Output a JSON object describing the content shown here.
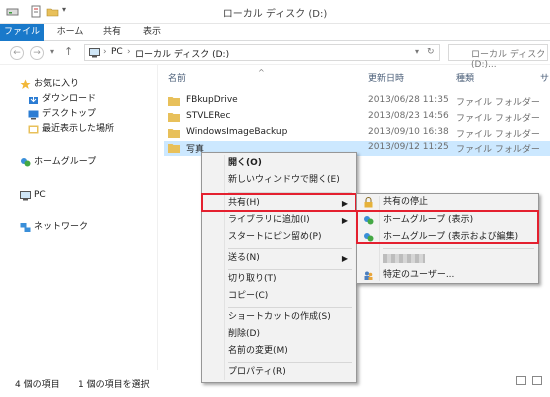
{
  "window": {
    "title": "ローカル ディスク (D:)"
  },
  "ribbon": {
    "tabs": [
      "ファイル",
      "ホーム",
      "共有",
      "表示"
    ]
  },
  "address": {
    "path": [
      "PC",
      "ローカル ディスク (D:)"
    ],
    "search_placeholder": "ローカル ディスク (D:)..."
  },
  "nav": {
    "favorites": "お気に入り",
    "downloads": "ダウンロード",
    "desktop": "デスクトップ",
    "recent": "最近表示した場所",
    "homegroup": "ホームグループ",
    "pc": "PC",
    "network": "ネットワーク"
  },
  "columns": {
    "name": "名前",
    "date": "更新日時",
    "type": "種類",
    "extra": "サ"
  },
  "files": [
    {
      "name": "FBkupDrive",
      "date": "2013/06/28 11:35",
      "type": "ファイル フォルダー"
    },
    {
      "name": "STVLERec",
      "date": "2013/08/23 14:56",
      "type": "ファイル フォルダー"
    },
    {
      "name": "WindowsImageBackup",
      "date": "2013/09/10 16:38",
      "type": "ファイル フォルダー"
    },
    {
      "name": "写真",
      "date": "2013/09/12 11:25",
      "type": "ファイル フォルダー"
    }
  ],
  "status": {
    "items": "4 個の項目",
    "selected": "1 個の項目を選択"
  },
  "context_menu": {
    "open": "開く(O)",
    "open_new_window": "新しいウィンドウで開く(E)",
    "share": "共有(H)",
    "add_library": "ライブラリに追加(I)",
    "pin_start": "スタートにピン留め(P)",
    "send_to": "送る(N)",
    "cut": "切り取り(T)",
    "copy": "コピー(C)",
    "create_shortcut": "ショートカットの作成(S)",
    "delete": "削除(D)",
    "rename": "名前の変更(M)",
    "properties": "プロパティ(R)"
  },
  "share_menu": {
    "stop_sharing": "共有の停止",
    "homegroup_view": "ホームグループ (表示)",
    "homegroup_edit": "ホームグループ (表示および編集)",
    "specific_users": "特定のユーザー..."
  },
  "colors": {
    "accent": "#1979ca",
    "selection": "#cce8ff",
    "highlight": "#e4202f",
    "folder": "#e8c05a"
  },
  "icons": {
    "folder": "folder-icon",
    "star": "star-icon",
    "homegroup": "homegroup-icon",
    "pc": "pc-icon",
    "network": "network-icon",
    "lock": "lock-icon"
  }
}
